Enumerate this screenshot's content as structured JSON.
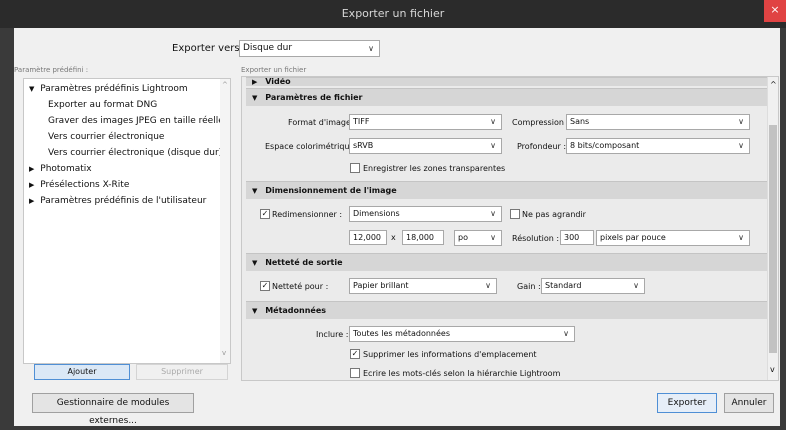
{
  "window": {
    "title": "Exporter un fichier",
    "close_glyph": "×"
  },
  "export_to": {
    "label": "Exporter vers :",
    "value": "Disque dur"
  },
  "presets": {
    "label": "Paramètre prédéfini :",
    "tree": [
      {
        "text": "Paramètres prédéfinis Lightroom",
        "expanded": true
      },
      {
        "text": "Exporter au format DNG"
      },
      {
        "text": "Graver des images JPEG en taille réelle"
      },
      {
        "text": "Vers courrier électronique"
      },
      {
        "text": "Vers courrier électronique (disque dur)"
      },
      {
        "text": "Photomatix"
      },
      {
        "text": "Présélections X-Rite"
      },
      {
        "text": "Paramètres prédéfinis de l'utilisateur"
      }
    ],
    "add_label": "Ajouter",
    "remove_label": "Supprimer"
  },
  "right": {
    "subtitle": "Exporter un fichier",
    "partial_header": "Vidéo",
    "file_settings": {
      "header": "Paramètres de fichier",
      "format_label": "Format d'image :",
      "format_value": "TIFF",
      "compression_label": "Compression :",
      "compression_value": "Sans",
      "colorspace_label": "Espace colorimétrique :",
      "colorspace_value": "sRVB",
      "depth_label": "Profondeur :",
      "depth_value": "8 bits/composant",
      "transparency_label": "Enregistrer les zones transparentes",
      "transparency_checked": false
    },
    "sizing": {
      "header": "Dimensionnement de l'image",
      "resize_label": "Redimensionner :",
      "resize_checked": true,
      "resize_value": "Dimensions",
      "no_enlarge_label": "Ne pas agrandir",
      "no_enlarge_checked": false,
      "width": "12,000",
      "times": "x",
      "height": "18,000",
      "unit": "po",
      "resolution_label": "Résolution :",
      "resolution": "300",
      "resolution_unit": "pixels par pouce"
    },
    "sharpening": {
      "header": "Netteté de sortie",
      "sharpen_label": "Netteté pour :",
      "sharpen_checked": true,
      "sharpen_value": "Papier brillant",
      "amount_label": "Gain :",
      "amount_value": "Standard"
    },
    "metadata": {
      "header": "Métadonnées",
      "include_label": "Inclure :",
      "include_value": "Toutes les métadonnées",
      "remove_location_label": "Supprimer les informations d'emplacement",
      "remove_location_checked": true,
      "keywords_label": "Ecrire les mots-clés selon la hiérarchie Lightroom",
      "keywords_checked": false
    }
  },
  "footer": {
    "plugin_manager": "Gestionnaire de modules externes...",
    "export": "Exporter",
    "cancel": "Annuler"
  },
  "icons": {
    "chevron_down": "∨",
    "triangle_down": "▼",
    "triangle_right": "▶",
    "check": "✓",
    "scroll_up": "^",
    "scroll_down": "v"
  }
}
